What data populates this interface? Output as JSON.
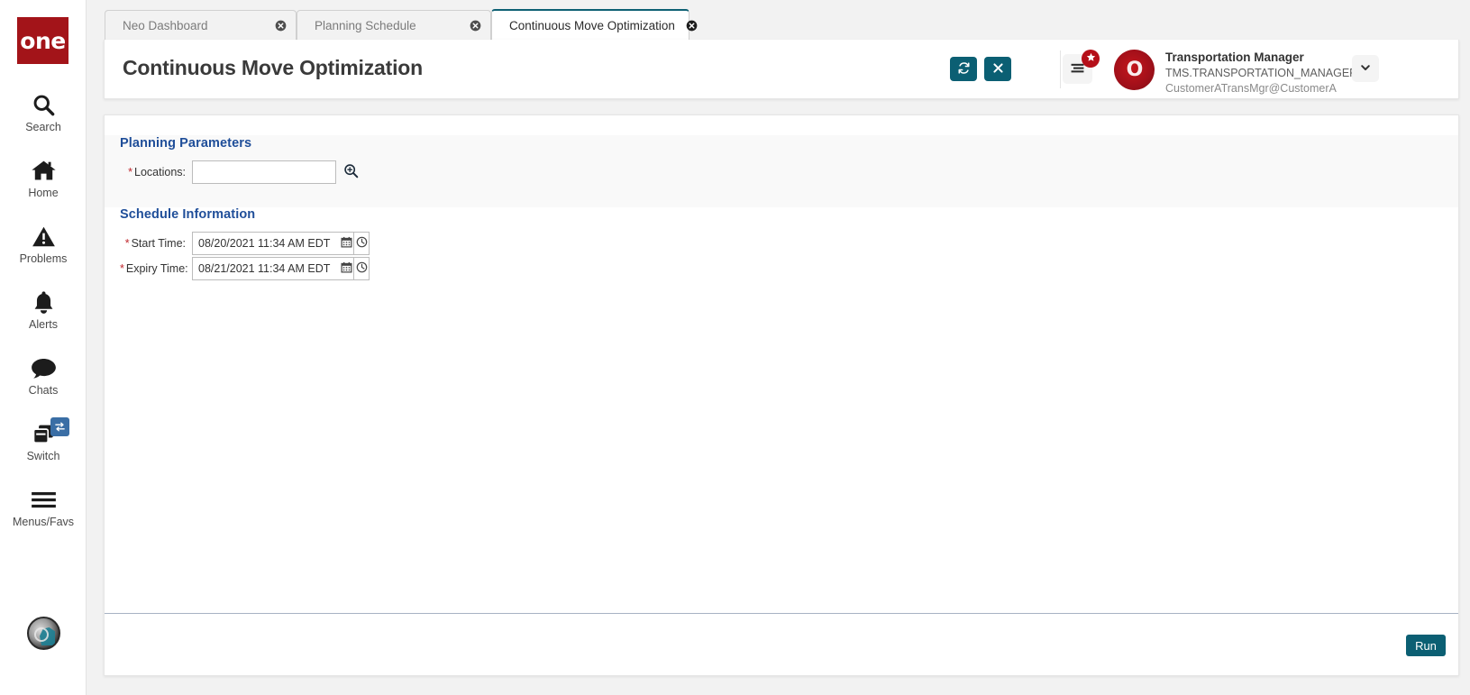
{
  "brand": {
    "logo_text": "one"
  },
  "sidebar": {
    "items": [
      {
        "label": "Search",
        "icon": "search-icon"
      },
      {
        "label": "Home",
        "icon": "home-icon"
      },
      {
        "label": "Problems",
        "icon": "warning-triangle-icon"
      },
      {
        "label": "Alerts",
        "icon": "bell-icon"
      },
      {
        "label": "Chats",
        "icon": "chat-bubble-icon"
      },
      {
        "label": "Switch",
        "icon": "windows-stack-icon",
        "badge_icon": "exchange-arrows-icon"
      },
      {
        "label": "Menus/Favs",
        "icon": "hamburger-icon"
      }
    ],
    "assistant_icon": "assistant-avatar-icon"
  },
  "tabs": [
    {
      "label": "Neo Dashboard",
      "active": false,
      "close_icon": "close-circle-icon"
    },
    {
      "label": "Planning Schedule",
      "active": false,
      "close_icon": "close-circle-icon"
    },
    {
      "label": "Continuous Move Optimization",
      "active": true,
      "close_icon": "close-circle-icon"
    }
  ],
  "header": {
    "title": "Continuous Move Optimization",
    "refresh_icon": "refresh-icon",
    "close_icon": "close-x-icon",
    "menu_icon": "list-menu-icon",
    "menu_badge_icon": "star-icon",
    "avatar_text": "O",
    "user": {
      "name": "Transportation Manager",
      "id": "TMS.TRANSPORTATION_MANAGER",
      "email": "CustomerATransMgr@CustomerA"
    },
    "chevron_icon": "chevron-down-icon"
  },
  "main": {
    "sections": [
      {
        "title": "Planning Parameters"
      },
      {
        "title": "Schedule Information"
      }
    ],
    "fields": {
      "locations": {
        "label": "Locations:",
        "required": true,
        "value": "",
        "placeholder": "",
        "picker_icon": "search-plus-icon"
      },
      "start_time": {
        "label": "Start Time:",
        "required": true,
        "value": "08/20/2021 11:34 AM EDT",
        "calendar_icon": "calendar-icon",
        "clock_icon": "clock-icon"
      },
      "expiry_time": {
        "label": "Expiry Time:",
        "required": true,
        "value": "08/21/2021 11:34 AM EDT",
        "calendar_icon": "calendar-icon",
        "clock_icon": "clock-icon"
      }
    },
    "footer": {
      "run_label": "Run"
    }
  },
  "colors": {
    "brand_red": "#a31419",
    "accent_teal": "#0b5f73",
    "section_heading_blue": "#1f4e99",
    "required_red": "#c0272d",
    "badge_red": "#b50f19",
    "switch_badge_blue": "#3a6ea5"
  }
}
